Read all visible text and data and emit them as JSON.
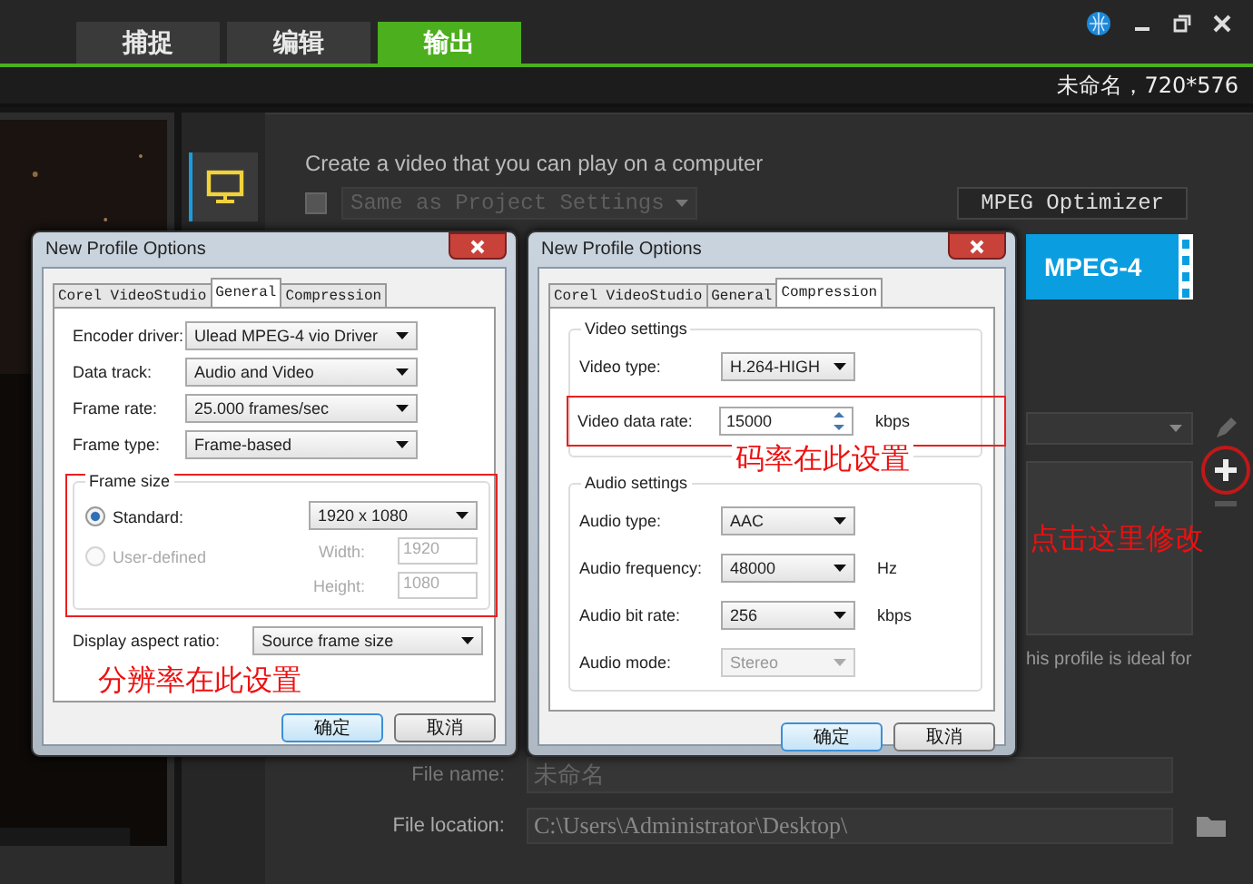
{
  "app_tabs": [
    {
      "label": "捕捉",
      "selected": false
    },
    {
      "label": "编辑",
      "selected": false
    },
    {
      "label": "输出",
      "selected": true
    }
  ],
  "project_info": "未命名，720*576",
  "output_panel": {
    "description": "Create a video that you can play on a computer",
    "same_as_project": {
      "label": "Same as Project Settings",
      "checked": false
    },
    "optimizer_button": "MPEG Optimizer",
    "format_tile": "MPEG-4",
    "profile_hint": "his profile is ideal for",
    "annotation": "点击这里修改",
    "file_name": {
      "label": "File name:",
      "value": "未命名"
    },
    "file_location": {
      "label": "File location:",
      "value": "C:\\Users\\Administrator\\Desktop\\"
    }
  },
  "dialogs": [
    {
      "title": "New Profile Options",
      "tabs": [
        {
          "label": "Corel VideoStudio",
          "selected": false
        },
        {
          "label": "General",
          "selected": true
        },
        {
          "label": "Compression",
          "selected": false
        }
      ],
      "sections": [
        {
          "kind": "rows",
          "rows": [
            {
              "kind": "dropdown",
              "label": "Encoder driver:",
              "value": "Ulead MPEG-4 vio Driver"
            },
            {
              "kind": "dropdown",
              "label": "Data track:",
              "value": "Audio and Video"
            },
            {
              "kind": "dropdown",
              "label": "Frame rate:",
              "value": "25.000 frames/sec"
            },
            {
              "kind": "dropdown",
              "label": "Frame type:",
              "value": "Frame-based"
            }
          ]
        },
        {
          "kind": "frame_size",
          "highlighted": true,
          "legend": "Frame size",
          "options": [
            {
              "label": "Standard:",
              "selected": true,
              "disabled": false
            },
            {
              "label": "User-defined",
              "selected": false,
              "disabled": true
            }
          ],
          "standard_value": "1920 x 1080",
          "width": {
            "label": "Width:",
            "value": "1920",
            "disabled": true
          },
          "height": {
            "label": "Height:",
            "value": "1080",
            "disabled": true
          }
        },
        {
          "kind": "rows",
          "rows": [
            {
              "kind": "dropdown",
              "label": "Display aspect ratio:",
              "value": "Source frame size"
            }
          ]
        }
      ],
      "annotation": "分辨率在此设置",
      "buttons": [
        "确定",
        "取消"
      ]
    },
    {
      "title": "New Profile Options",
      "tabs": [
        {
          "label": "Corel VideoStudio",
          "selected": false
        },
        {
          "label": "General",
          "selected": false
        },
        {
          "label": "Compression",
          "selected": true
        }
      ],
      "sections": [
        {
          "kind": "group",
          "legend": "Video settings",
          "rows": [
            {
              "kind": "dropdown",
              "label": "Video type:",
              "value": "H.264-HIGH",
              "disabled": false
            },
            {
              "kind": "spin",
              "label": "Video data rate:",
              "value": "15000",
              "unit": "kbps",
              "disabled": false,
              "highlighted": true
            }
          ]
        },
        {
          "kind": "group",
          "legend": "Audio settings",
          "rows": [
            {
              "kind": "dropdown",
              "label": "Audio type:",
              "value": "AAC",
              "disabled": false
            },
            {
              "kind": "dropdown",
              "label": "Audio frequency:",
              "value": "48000",
              "unit": "Hz",
              "disabled": false
            },
            {
              "kind": "dropdown",
              "label": "Audio bit rate:",
              "value": "256",
              "unit": "kbps",
              "disabled": false
            },
            {
              "kind": "dropdown",
              "label": "Audio mode:",
              "value": "Stereo",
              "disabled": true
            }
          ]
        }
      ],
      "annotation": "码率在此设置",
      "buttons": [
        "确定",
        "取消"
      ]
    }
  ]
}
